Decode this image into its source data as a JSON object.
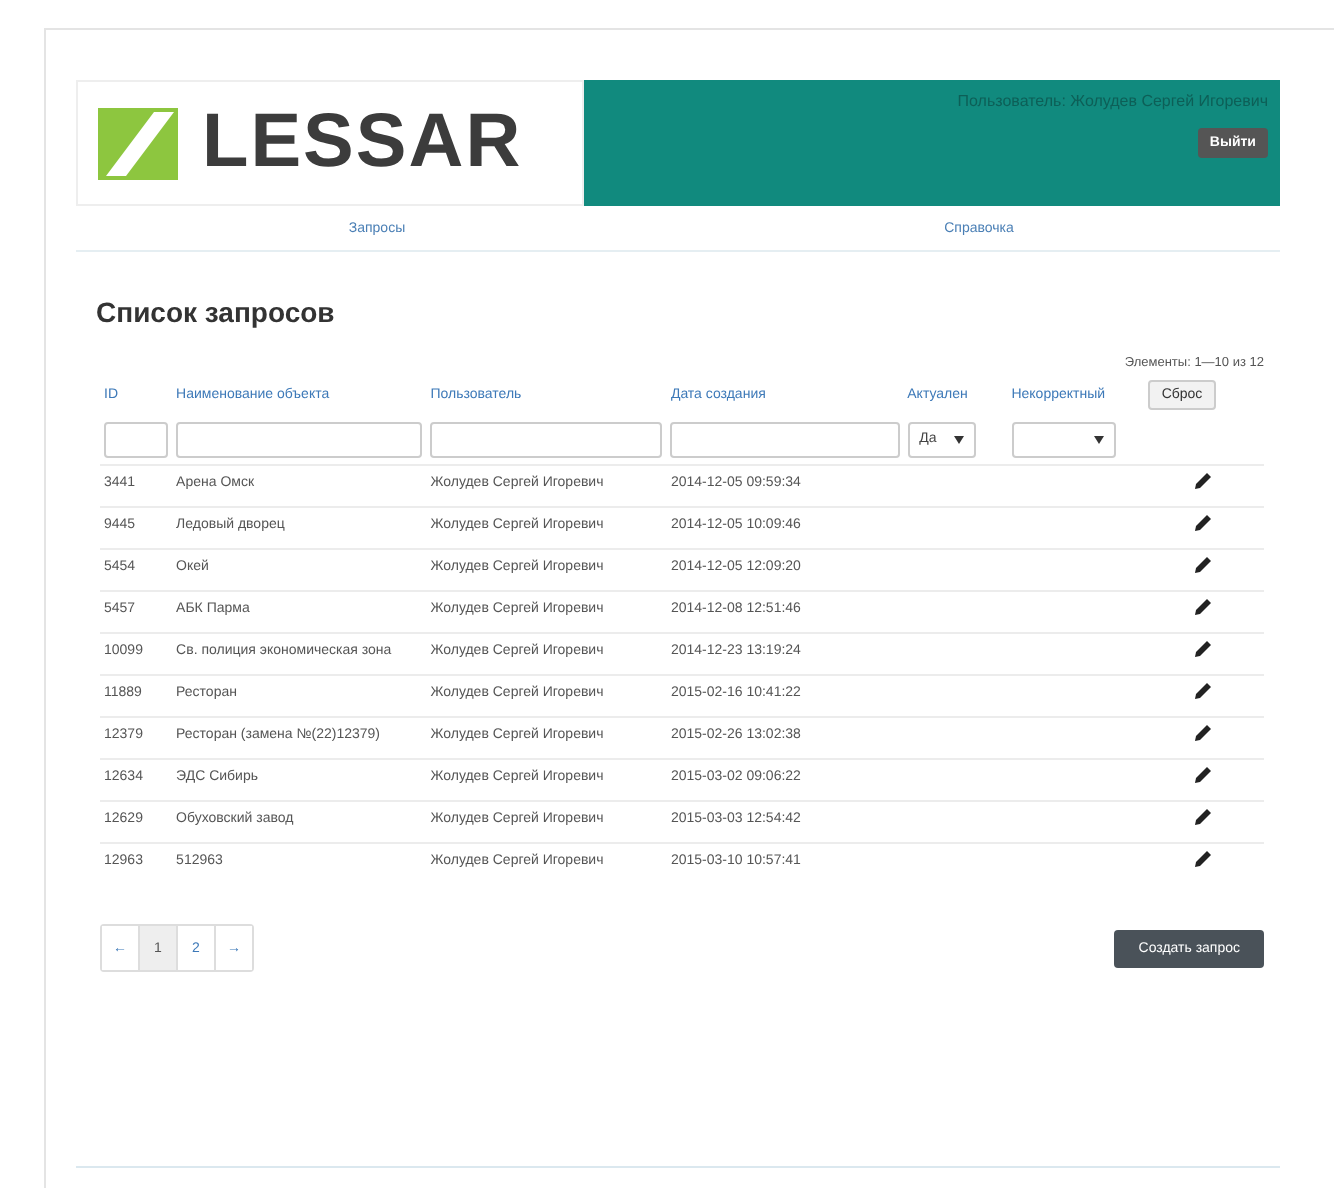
{
  "header": {
    "logo": "LESSAR",
    "user": "Пользователь: Жолудев Сергей Игоревич",
    "logout": "Выйти"
  },
  "nav": [
    {
      "label": "Запросы"
    },
    {
      "label": "Справочка"
    }
  ],
  "title": "Список запросов",
  "summary": "Элементы: 1—10 из 12",
  "table": {
    "columns": [
      "ID",
      "Наименование объекта",
      "Пользователь",
      "Дата создания",
      "Актуален",
      "Некорректный"
    ],
    "reset": "Сброс",
    "filters": [
      {
        "kind": "text"
      },
      {
        "kind": "text"
      },
      {
        "kind": "text"
      },
      {
        "kind": "text"
      },
      {
        "kind": "select",
        "value": "Да"
      },
      {
        "kind": "select"
      }
    ],
    "rows": [
      {
        "id": "3441",
        "name": "Арена Омск",
        "user": "Жолудев Сергей Игоревич",
        "date": "2014-12-05 09:59:34"
      },
      {
        "id": "9445",
        "name": "Ледовый дворец",
        "user": "Жолудев Сергей Игоревич",
        "date": "2014-12-05 10:09:46"
      },
      {
        "id": "5454",
        "name": "Окей",
        "user": "Жолудев Сергей Игоревич",
        "date": "2014-12-05 12:09:20"
      },
      {
        "id": "5457",
        "name": "АБК Парма",
        "user": "Жолудев Сергей Игоревич",
        "date": "2014-12-08 12:51:46"
      },
      {
        "id": "10099",
        "name": "Св. полиция экономическая зона",
        "user": "Жолудев Сергей Игоревич",
        "date": "2014-12-23 13:19:24"
      },
      {
        "id": "11889",
        "name": "Ресторан",
        "user": "Жолудев Сергей Игоревич",
        "date": "2015-02-16 10:41:22"
      },
      {
        "id": "12379",
        "name": "Ресторан (замена №(22)12379)",
        "user": "Жолудев Сергей Игоревич",
        "date": "2015-02-26 13:02:38"
      },
      {
        "id": "12634",
        "name": "ЭДС Сибирь",
        "user": "Жолудев Сергей Игоревич",
        "date": "2015-03-02 09:06:22"
      },
      {
        "id": "12629",
        "name": "Обуховский завод",
        "user": "Жолудев Сергей Игоревич",
        "date": "2015-03-03 12:54:42"
      },
      {
        "id": "12963",
        "name": "512963",
        "user": "Жолудев Сергей Игоревич",
        "date": "2015-03-10 10:57:41"
      }
    ]
  },
  "pager": [
    {
      "label": "←",
      "selected": false
    },
    {
      "label": "1",
      "selected": true
    },
    {
      "label": "2",
      "selected": false
    },
    {
      "label": "→",
      "selected": false
    }
  ],
  "create_button": "Создать запрос"
}
